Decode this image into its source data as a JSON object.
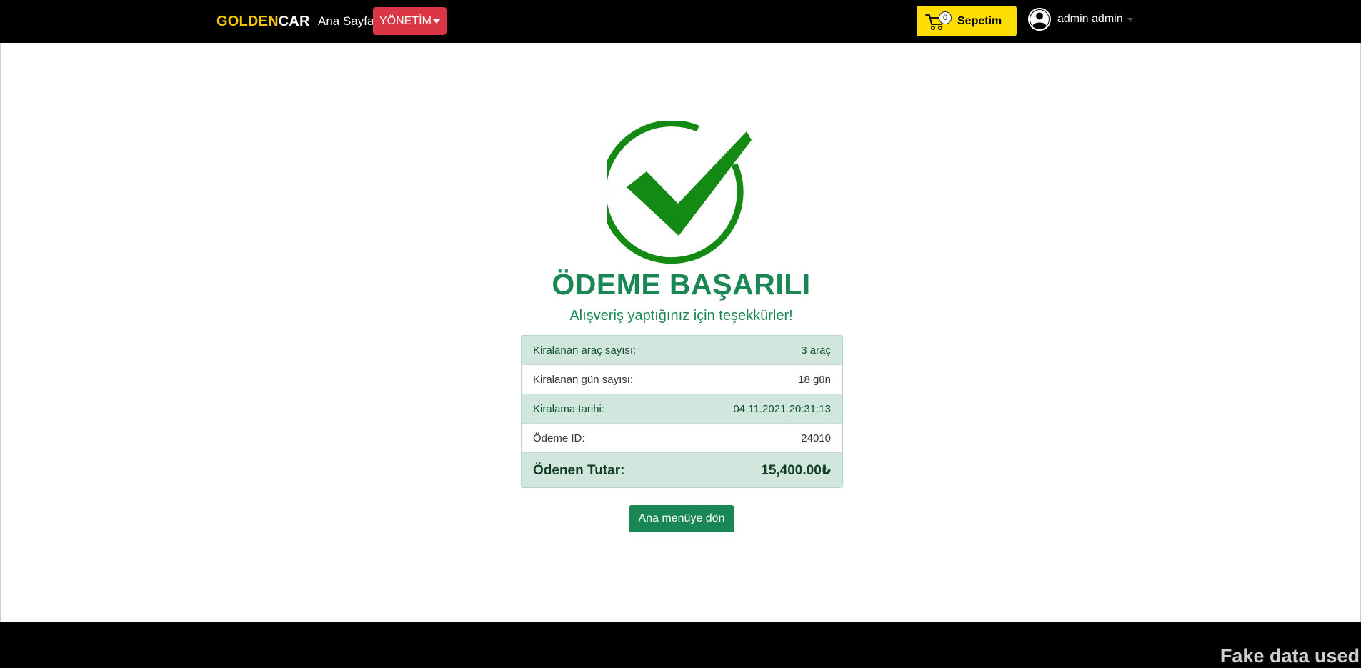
{
  "navbar": {
    "brand_gold": "GOLDEN",
    "brand_white": "CAR",
    "home_link": "Ana Sayfa",
    "admin_dropdown": "YÖNETİM",
    "cart": {
      "count": "0",
      "label": "Sepetim"
    },
    "user": {
      "name": "admin admin"
    }
  },
  "main": {
    "title": "ÖDEME BAŞARILI",
    "subtitle": "Alışveriş yaptığınız için teşekkürler!",
    "summary": [
      {
        "label": "Kiralanan araç sayısı:",
        "value": "3 araç"
      },
      {
        "label": "Kiralanan gün sayısı:",
        "value": "18 gün"
      },
      {
        "label": "Kiralama tarihi:",
        "value": "04.11.2021 20:31:13"
      },
      {
        "label": "Ödeme ID:",
        "value": "24010"
      }
    ],
    "total": {
      "label": "Ödenen Tutar:",
      "value": "15,400.00₺"
    },
    "back_button": "Ana menüye dön"
  },
  "footer": {
    "watermark": "Fake data used"
  },
  "colors": {
    "brand_gold": "#f6c700",
    "danger": "#dc3545",
    "cart_yellow": "#ffdd00",
    "success": "#198754",
    "success_light": "#d1e7dd",
    "check_green": "#138a13"
  },
  "icons": {
    "cart": "shopping-cart-icon",
    "user": "user-circle-icon",
    "success": "checkmark-circle-icon"
  }
}
